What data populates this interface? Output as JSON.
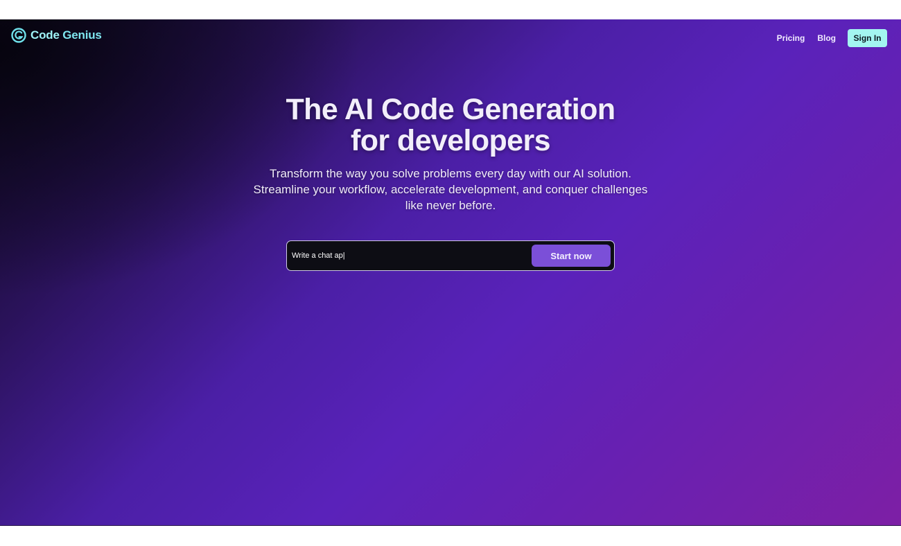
{
  "brand": {
    "name_part1": "Code",
    "name_part2": " Genius",
    "icon": "code-genius-logo-icon",
    "color": "#7ee6ee"
  },
  "nav": {
    "links": [
      {
        "label": "Pricing"
      },
      {
        "label": "Blog"
      }
    ],
    "signin_label": "Sign In",
    "signin_color": "#a3f5f0"
  },
  "hero": {
    "title_line1": "The AI Code Generation",
    "title_line2": "for developers",
    "subtitle_line1": "Transform the way you solve problems every day with our AI solution.",
    "subtitle_line2": "Streamline your workflow, accelerate development, and conquer challenges",
    "subtitle_line3": "like never before.",
    "prompt_value": "Write a chat ap|",
    "start_label": "Start now",
    "start_color": "#7b4fd8"
  }
}
